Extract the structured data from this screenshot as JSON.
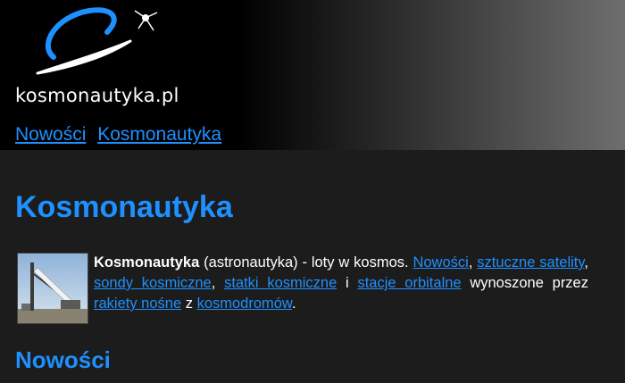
{
  "header": {
    "brand": "kosmonautyka.pl",
    "nav": [
      {
        "label": "Nowości"
      },
      {
        "label": "Kosmonautyka"
      }
    ]
  },
  "main": {
    "title": "Kosmonautyka",
    "intro": {
      "term": "Kosmonautyka",
      "t1": " (astronautyka) - loty w kosmos. ",
      "link_news": "Nowości",
      "sep1": ", ",
      "link_satellites": "sztuczne satelity",
      "sep2": ", ",
      "link_probes": "sondy kosmiczne",
      "sep3": ", ",
      "link_spacecraft": "statki kosmiczne",
      "sep4": " i ",
      "link_stations": "stacje orbitalne",
      "t2": " wynoszone przez ",
      "link_rockets": "rakiety nośne",
      "t3": " z ",
      "link_spaceports": "kosmodromów",
      "t4": "."
    },
    "section_title": "Nowości"
  },
  "colors": {
    "link": "#1e90ff",
    "background": "#1c1c1c",
    "header_dark": "#000000",
    "header_light": "#6e6e6e"
  },
  "icons": [
    "logo-orbit-icon",
    "satellite-icon",
    "rocket-thumbnail"
  ]
}
